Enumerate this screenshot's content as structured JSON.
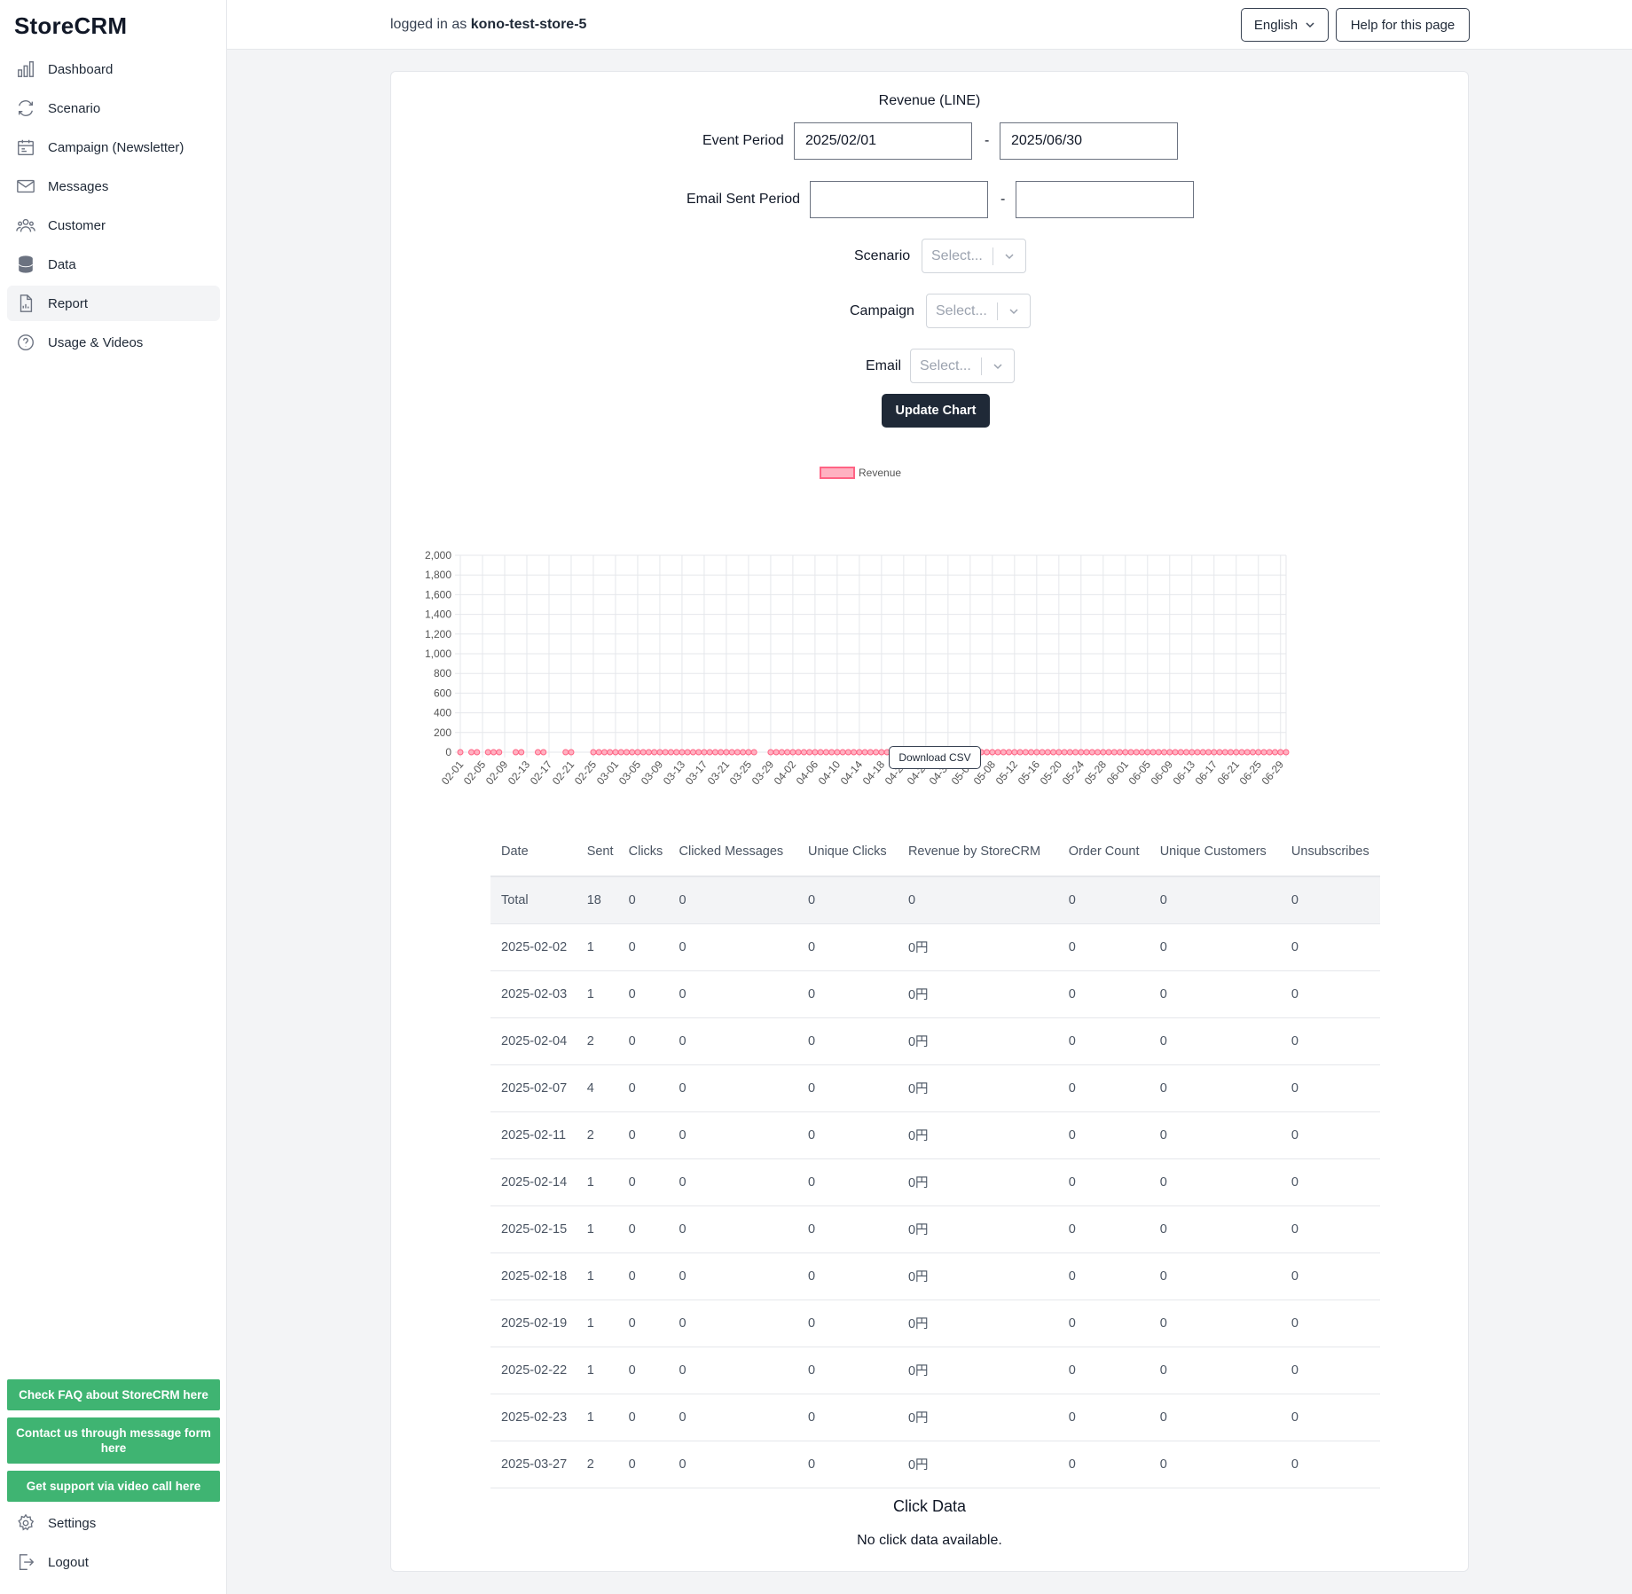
{
  "app": {
    "name": "StoreCRM"
  },
  "sidebar": {
    "items": [
      {
        "label": "Dashboard",
        "icon": "bar-chart-icon"
      },
      {
        "label": "Scenario",
        "icon": "refresh-icon"
      },
      {
        "label": "Campaign (Newsletter)",
        "icon": "calendar-icon"
      },
      {
        "label": "Messages",
        "icon": "envelope-icon"
      },
      {
        "label": "Customer",
        "icon": "users-icon"
      },
      {
        "label": "Data",
        "icon": "database-icon"
      },
      {
        "label": "Report",
        "icon": "report-icon",
        "active": true
      },
      {
        "label": "Usage & Videos",
        "icon": "question-icon"
      }
    ],
    "support": {
      "faq": "Check FAQ about StoreCRM here",
      "contact": "Contact us through message form here",
      "video": "Get support via video call here"
    },
    "settings": "Settings",
    "logout": "Logout"
  },
  "header": {
    "logged_prefix": "logged in as",
    "store": "kono-test-store-5",
    "language": "English",
    "help": "Help for this page"
  },
  "form": {
    "title": "Revenue (LINE)",
    "event_period_label": "Event Period",
    "event_start": "2025/02/01",
    "event_end": "2025/06/30",
    "email_sent_label": "Email Sent Period",
    "email_start": "",
    "email_end": "",
    "dash": "-",
    "scenario_label": "Scenario",
    "campaign_label": "Campaign",
    "email_label": "Email",
    "select_placeholder": "Select...",
    "update_button": "Update Chart"
  },
  "chart_data": {
    "type": "line",
    "series": [
      {
        "name": "Revenue",
        "color": "#ff6384",
        "value": 0
      }
    ],
    "ylim": [
      0,
      2000
    ],
    "yticks": [
      0,
      200,
      400,
      600,
      800,
      1000,
      1200,
      1400,
      1600,
      1800,
      2000
    ],
    "x_start": "2025-02-01",
    "x_end": "2025-06-30",
    "dates_with_data": [
      "02-01",
      "02-03",
      "02-04",
      "02-06",
      "02-07",
      "02-08",
      "02-11",
      "02-12",
      "02-15",
      "02-16",
      "02-20",
      "02-21",
      "02-25 to 03-26",
      "03-29 to 06-30"
    ],
    "xtick_labels": [
      "02-01",
      "02-05",
      "02-09",
      "02-13",
      "02-17",
      "02-21",
      "02-25",
      "03-01",
      "03-05",
      "03-09",
      "03-13",
      "03-17",
      "03-21",
      "03-25",
      "03-29",
      "04-02",
      "04-06",
      "04-10",
      "04-14",
      "04-18",
      "04-22",
      "04-26",
      "04-30",
      "05-04",
      "05-08",
      "05-12",
      "05-16",
      "05-20",
      "05-24",
      "05-28",
      "06-01",
      "06-05",
      "06-09",
      "06-13",
      "06-17",
      "06-21",
      "06-25",
      "06-29"
    ],
    "legend": "top-center",
    "grid": true
  },
  "csv_button": "Download CSV",
  "table": {
    "columns": [
      "Date",
      "Sent",
      "Clicks",
      "Clicked Messages",
      "Unique Clicks",
      "Revenue by StoreCRM",
      "Order Count",
      "Unique Customers",
      "Unsubscribes"
    ],
    "total": [
      "Total",
      "18",
      "0",
      "0",
      "0",
      "0",
      "0",
      "0",
      "0"
    ],
    "rows": [
      [
        "2025-02-02",
        "1",
        "0",
        "0",
        "0",
        "0円",
        "0",
        "0",
        "0"
      ],
      [
        "2025-02-03",
        "1",
        "0",
        "0",
        "0",
        "0円",
        "0",
        "0",
        "0"
      ],
      [
        "2025-02-04",
        "2",
        "0",
        "0",
        "0",
        "0円",
        "0",
        "0",
        "0"
      ],
      [
        "2025-02-07",
        "4",
        "0",
        "0",
        "0",
        "0円",
        "0",
        "0",
        "0"
      ],
      [
        "2025-02-11",
        "2",
        "0",
        "0",
        "0",
        "0円",
        "0",
        "0",
        "0"
      ],
      [
        "2025-02-14",
        "1",
        "0",
        "0",
        "0",
        "0円",
        "0",
        "0",
        "0"
      ],
      [
        "2025-02-15",
        "1",
        "0",
        "0",
        "0",
        "0円",
        "0",
        "0",
        "0"
      ],
      [
        "2025-02-18",
        "1",
        "0",
        "0",
        "0",
        "0円",
        "0",
        "0",
        "0"
      ],
      [
        "2025-02-19",
        "1",
        "0",
        "0",
        "0",
        "0円",
        "0",
        "0",
        "0"
      ],
      [
        "2025-02-22",
        "1",
        "0",
        "0",
        "0",
        "0円",
        "0",
        "0",
        "0"
      ],
      [
        "2025-02-23",
        "1",
        "0",
        "0",
        "0",
        "0円",
        "0",
        "0",
        "0"
      ],
      [
        "2025-03-27",
        "2",
        "0",
        "0",
        "0",
        "0円",
        "0",
        "0",
        "0"
      ]
    ]
  },
  "click_data": {
    "title": "Click Data",
    "empty": "No click data available."
  }
}
